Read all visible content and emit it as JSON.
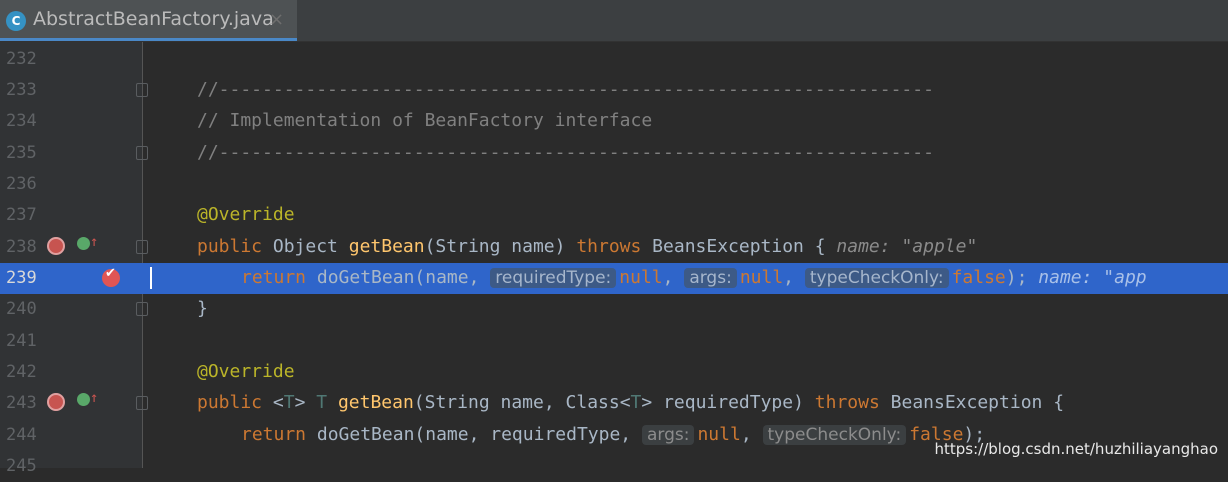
{
  "tab": {
    "icon": "C",
    "filename": "AbstractBeanFactory.java",
    "close": "×"
  },
  "lines": [
    {
      "num": "232"
    },
    {
      "num": "233",
      "text": "//------------------------------------------------------------------"
    },
    {
      "num": "234",
      "text": "// Implementation of BeanFactory interface"
    },
    {
      "num": "235",
      "text": "//------------------------------------------------------------------"
    },
    {
      "num": "236"
    },
    {
      "num": "237",
      "annotation": "@Override"
    },
    {
      "num": "238",
      "kw_public": "public",
      "type": " Object ",
      "method": "getBean",
      "params": "(String name) ",
      "kw_throws": "throws",
      "exc": " BeansException { ",
      "debug": "name: \"apple\""
    },
    {
      "num": "239",
      "kw_return": "return",
      "call": " doGetBean(name, ",
      "hint1": "requiredType:",
      "null1": "null",
      "comma1": ", ",
      "hint2": "args:",
      "null2": "null",
      "comma2": ", ",
      "hint3": "typeCheckOnly:",
      "kw_false": "false",
      "end": "); ",
      "debug": "name: \"app"
    },
    {
      "num": "240",
      "text": "}"
    },
    {
      "num": "241"
    },
    {
      "num": "242",
      "annotation": "@Override"
    },
    {
      "num": "243",
      "kw_public": "public",
      "lt": " <",
      "tparam": "T",
      "gt": "> ",
      "tparam2": "T",
      "space": " ",
      "method": "getBean",
      "params": "(String name, Class<",
      "tparam3": "T",
      "params2": "> requiredType) ",
      "kw_throws": "throws",
      "exc": " BeansException {"
    },
    {
      "num": "244",
      "kw_return": "return",
      "call": " doGetBean(name, requiredType, ",
      "hint1": "args:",
      "null1": "null",
      "comma1": ", ",
      "hint2": "typeCheckOnly:",
      "kw_false": "false",
      "end": ");"
    },
    {
      "num": "245"
    }
  ],
  "watermark": "https://blog.csdn.net/huzhiliayanghao",
  "icons": [
    "class-file-icon",
    "fold-marker-icon",
    "implementing-method-icon",
    "overriding-method-icon",
    "breakpoint-icon"
  ]
}
